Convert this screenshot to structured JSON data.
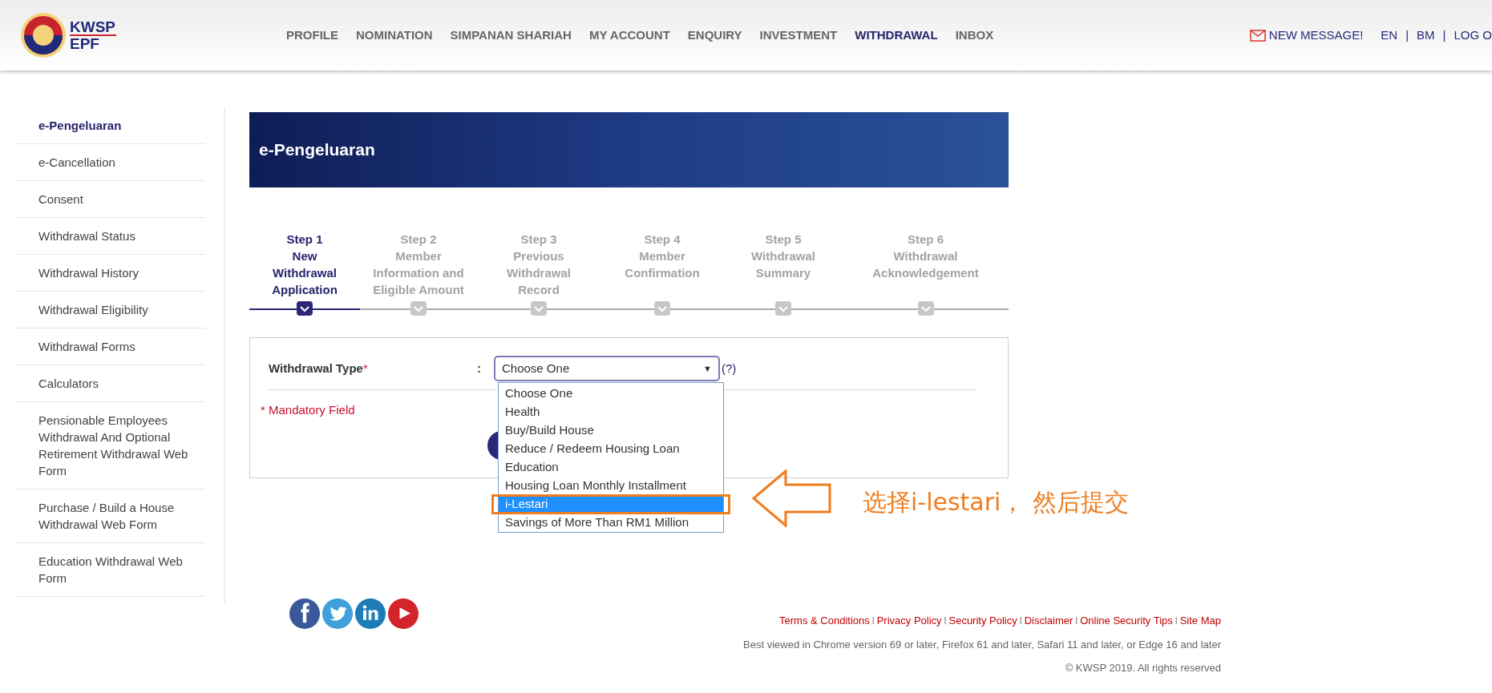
{
  "header": {
    "logo": {
      "line1": "KWSP",
      "line2": "EPF"
    },
    "nav": [
      {
        "label": "PROFILE",
        "selected": false
      },
      {
        "label": "NOMINATION",
        "selected": false
      },
      {
        "label": "SIMPANAN SHARIAH",
        "selected": false
      },
      {
        "label": "MY ACCOUNT",
        "selected": false
      },
      {
        "label": "ENQUIRY",
        "selected": false
      },
      {
        "label": "INVESTMENT",
        "selected": false
      },
      {
        "label": "WITHDRAWAL",
        "selected": true
      },
      {
        "label": "INBOX",
        "selected": false
      }
    ],
    "new_message": "NEW MESSAGE!",
    "languages": [
      "EN",
      "BM",
      "LOG O"
    ],
    "separator": "|"
  },
  "sidebar": {
    "items": [
      {
        "label": "e-Pengeluaran",
        "selected": true
      },
      {
        "label": "e-Cancellation",
        "selected": false
      },
      {
        "label": "Consent",
        "selected": false
      },
      {
        "label": "Withdrawal Status",
        "selected": false
      },
      {
        "label": "Withdrawal History",
        "selected": false
      },
      {
        "label": "Withdrawal Eligibility",
        "selected": false
      },
      {
        "label": "Withdrawal Forms",
        "selected": false
      },
      {
        "label": "Calculators",
        "selected": false
      },
      {
        "label": "Pensionable Employees Withdrawal And Optional Retirement Withdrawal Web Form",
        "selected": false
      },
      {
        "label": "Purchase / Build a House Withdrawal Web Form",
        "selected": false
      },
      {
        "label": "Education Withdrawal Web Form",
        "selected": false
      }
    ]
  },
  "banner": {
    "title": "e-Pengeluaran"
  },
  "steps": [
    {
      "lines": [
        "Step 1",
        "New",
        "Withdrawal",
        "Application"
      ],
      "selected": true
    },
    {
      "lines": [
        "Step 2",
        "Member",
        "Information and",
        "Eligible Amount"
      ],
      "selected": false
    },
    {
      "lines": [
        "Step 3",
        "Previous",
        "Withdrawal",
        "Record"
      ],
      "selected": false
    },
    {
      "lines": [
        "Step 4",
        "Member",
        "Confirmation"
      ],
      "selected": false
    },
    {
      "lines": [
        "Step 5",
        "Withdrawal",
        "Summary"
      ],
      "selected": false
    },
    {
      "lines": [
        "Step 6",
        "Withdrawal",
        "Acknowledgement"
      ],
      "selected": false
    }
  ],
  "form": {
    "label": "Withdrawal Type",
    "required_mark": "*",
    "colon": ":",
    "select_value": "Choose One",
    "caret": "▼",
    "help": "(?)",
    "mandatory_note": "* Mandatory Field",
    "options": [
      {
        "label": "Choose One",
        "selected": false
      },
      {
        "label": "Health",
        "selected": false
      },
      {
        "label": "Buy/Build House",
        "selected": false
      },
      {
        "label": "Reduce / Redeem Housing Loan",
        "selected": false
      },
      {
        "label": "Education",
        "selected": false
      },
      {
        "label": "Housing Loan Monthly Installment",
        "selected": false
      },
      {
        "label": "i-Lestari",
        "selected": true
      },
      {
        "label": "Savings of More Than RM1 Million",
        "selected": false
      }
    ]
  },
  "annotation": {
    "text": "选择i-lestari， 然后提交"
  },
  "footer": {
    "social": [
      {
        "kind": "facebook",
        "color": "#3b5998"
      },
      {
        "kind": "twitter",
        "color": "#3fa0dc"
      },
      {
        "kind": "linkedin",
        "color": "#1d7bb7"
      },
      {
        "kind": "youtube",
        "color": "#d3232b"
      }
    ],
    "links": [
      "Terms & Conditions",
      "Privacy Policy",
      "Security Policy",
      "Disclaimer",
      "Online Security Tips",
      "Site Map"
    ],
    "link_separators": [
      "l",
      "l",
      "l",
      "l",
      "l"
    ],
    "browsers": "Best viewed in Chrome version 69 or later, Firefox 61 and later, Safari 11 and later, or Edge 16 and later",
    "copyright": "© KWSP 2019. All rights reserved"
  }
}
